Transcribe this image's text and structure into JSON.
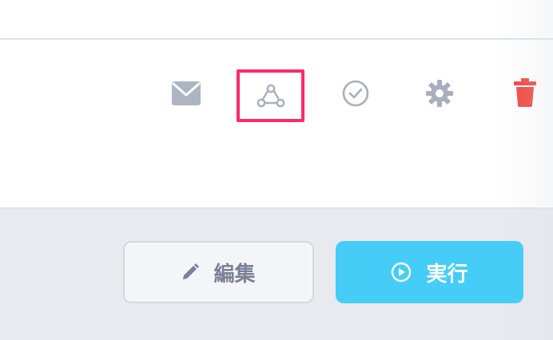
{
  "toolbar": {
    "icons": [
      "mail-icon",
      "webhook-icon",
      "clock-icon",
      "gear-icon",
      "trash-icon"
    ],
    "selected": "webhook-icon"
  },
  "actions": {
    "edit_label": "編集",
    "run_label": "実行"
  },
  "colors": {
    "highlight": "#ff2a6b",
    "run_button": "#45cdf7",
    "delete": "#f2443f",
    "icon_gray": "#a9afbd"
  }
}
